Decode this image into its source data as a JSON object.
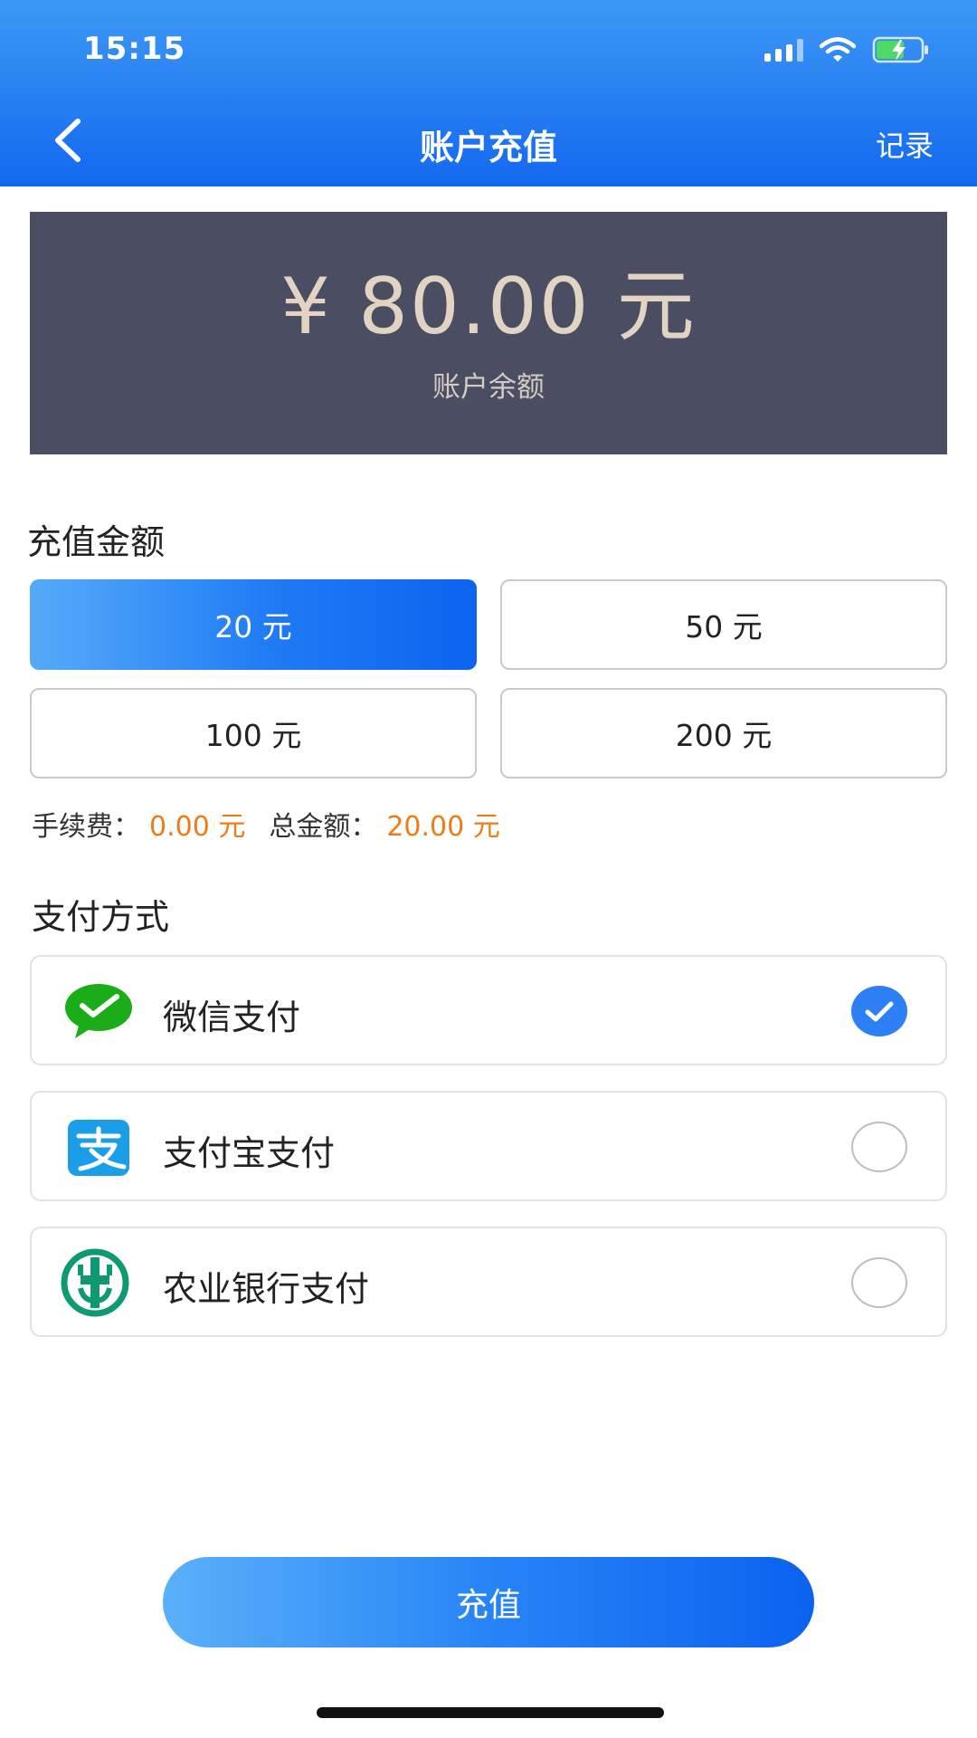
{
  "status_bar": {
    "time": "15:15"
  },
  "header": {
    "title": "账户充值",
    "record_link": "记录"
  },
  "balance": {
    "amount": "¥ 80.00 元",
    "label": "账户余额"
  },
  "recharge": {
    "section_title": "充值金额",
    "options": [
      {
        "label": "20 元",
        "selected": true
      },
      {
        "label": "50 元",
        "selected": false
      },
      {
        "label": "100 元",
        "selected": false
      },
      {
        "label": "200 元",
        "selected": false
      }
    ],
    "fee_label": "手续费：",
    "fee_value": "0.00 元",
    "total_label": "总金额：",
    "total_value": "20.00 元"
  },
  "payment": {
    "section_title": "支付方式",
    "methods": [
      {
        "label": "微信支付",
        "icon": "wechat-pay-icon",
        "checked": true
      },
      {
        "label": "支付宝支付",
        "icon": "alipay-icon",
        "checked": false
      },
      {
        "label": "农业银行支付",
        "icon": "abc-bank-icon",
        "checked": false
      }
    ]
  },
  "submit_label": "充值",
  "colors": {
    "header_gradient": [
      "#3d98f5",
      "#1468f0"
    ],
    "balance_card": "#4b4e62",
    "accent_orange": "#ec7c18",
    "wechat_green": "#1aad19",
    "alipay_blue": "#1a9ee8",
    "abc_green": "#0d9a73"
  }
}
